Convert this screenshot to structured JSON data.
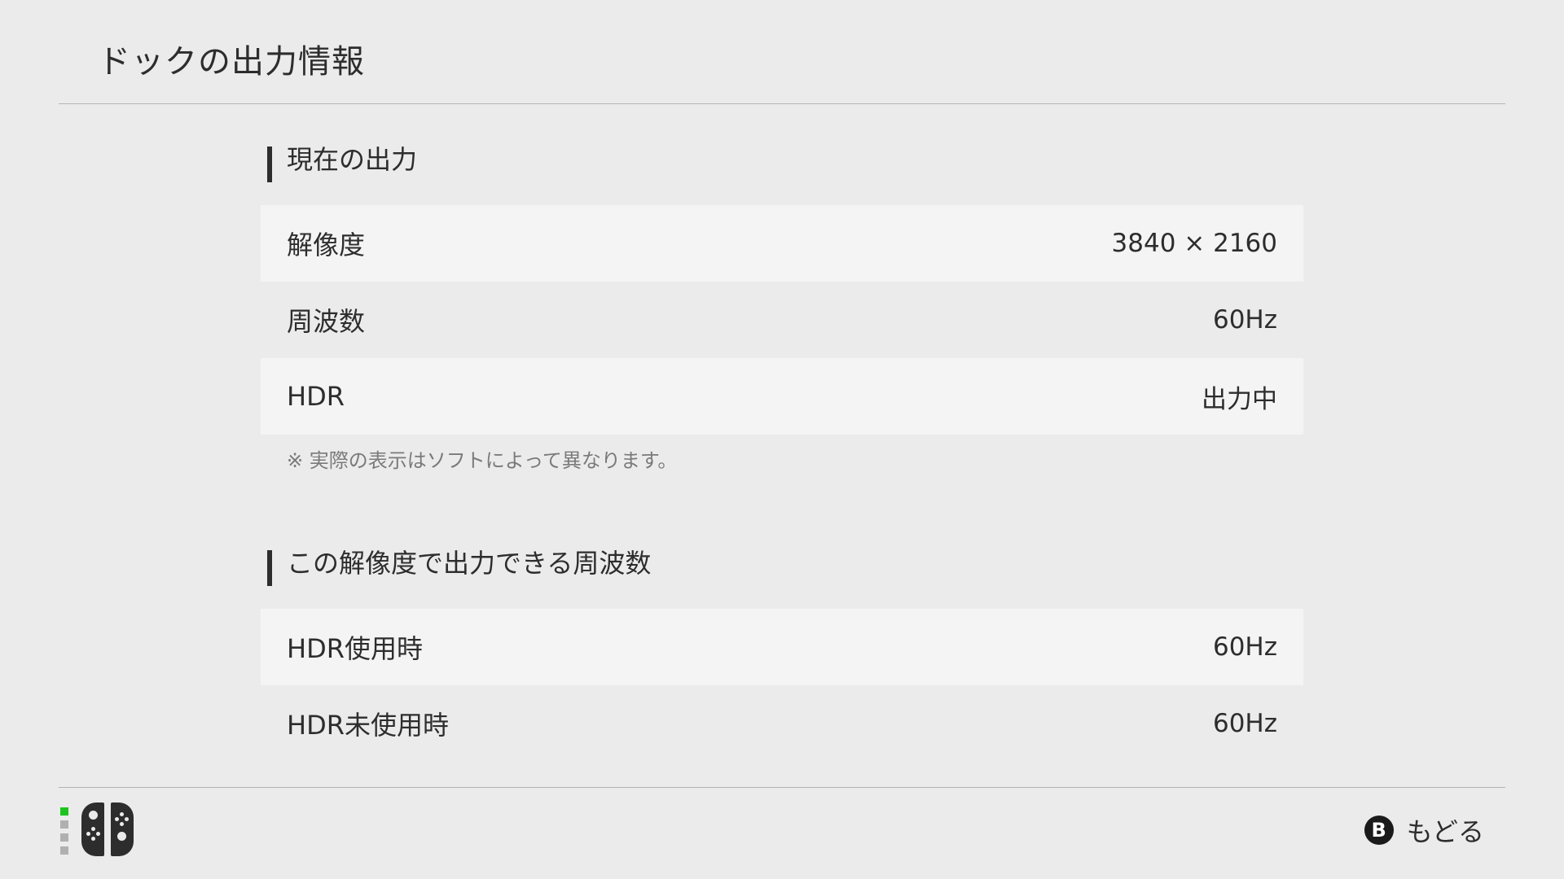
{
  "header": {
    "title": "ドックの出力情報"
  },
  "current_output": {
    "heading": "現在の出力",
    "rows": [
      {
        "label": "解像度",
        "value": "3840 × 2160"
      },
      {
        "label": "周波数",
        "value": "60Hz"
      },
      {
        "label": "HDR",
        "value": "出力中"
      }
    ],
    "note": "※ 実際の表示はソフトによって異なります。"
  },
  "available_frequencies": {
    "heading": "この解像度で出力できる周波数",
    "rows": [
      {
        "label": "HDR使用時",
        "value": "60Hz"
      },
      {
        "label": "HDR未使用時",
        "value": "60Hz"
      }
    ]
  },
  "footer": {
    "back_label": "もどる",
    "back_button_glyph": "B",
    "controller_icon": "joy-con-pair-icon",
    "player_indicator_active": 1,
    "player_indicator_count": 4,
    "colors": {
      "active_player": "#1ec31e",
      "inactive_player": "#b0b0b0",
      "controller": "#2d2d2d"
    }
  }
}
